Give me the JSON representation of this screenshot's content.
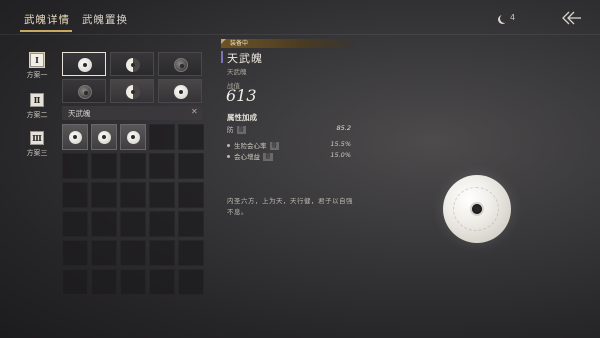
{
  "tabs": [
    {
      "label": "武魄详情",
      "active": true
    },
    {
      "label": "武魄置换",
      "active": false
    }
  ],
  "top_right": {
    "moon_count": "4",
    "moon_icon": "moon-icon",
    "back_icon": "back-arrow-icon"
  },
  "plans": [
    {
      "label": "方案一",
      "glyph": "Ⅰ",
      "active": true
    },
    {
      "label": "方案二",
      "glyph": "Ⅱ",
      "active": false
    },
    {
      "label": "方案三",
      "glyph": "Ⅲ",
      "active": false
    }
  ],
  "slots": [
    {
      "disc": "light",
      "selected": true
    },
    {
      "disc": "half",
      "selected": false
    },
    {
      "disc": "dark",
      "selected": false
    },
    {
      "disc": "dark",
      "selected": false
    },
    {
      "disc": "half",
      "selected": false
    },
    {
      "disc": "light",
      "selected": false
    }
  ],
  "inventory": {
    "set_name": "天武魄",
    "close_label": "✕",
    "filled_count": 3
  },
  "detail": {
    "equipped_tag": "装备中",
    "name": "天武魄",
    "subtitle": "天武魄",
    "power_label": "战值",
    "power_value": "613",
    "attr_title": "属性加成",
    "main_attr": {
      "name": "防",
      "tag": "普",
      "value": "85.2"
    },
    "sub_attrs": [
      {
        "name": "生险会心率",
        "tag": "普",
        "value": "15.5%"
      },
      {
        "name": "会心增益",
        "tag": "普",
        "value": "15.0%"
      }
    ],
    "flavor": "内圣六方，上为天，天行健，君子以自强不息。"
  },
  "colors": {
    "accent_gold": "#c9a860",
    "equipped_tag": "#6d5426",
    "name_bar": "#7d72b8"
  }
}
